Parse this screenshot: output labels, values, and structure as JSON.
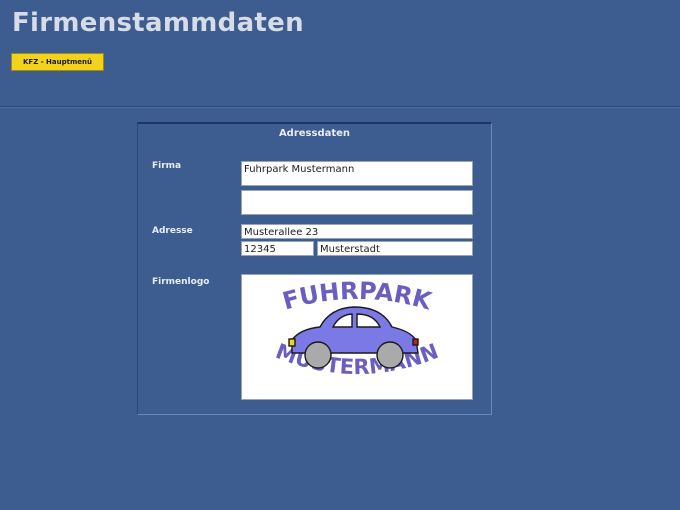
{
  "page": {
    "title": "Firmenstammdaten",
    "menu_button": "KFZ - Hauptmenü"
  },
  "panel": {
    "title": "Adressdaten",
    "labels": {
      "firma": "Firma",
      "adresse": "Adresse",
      "firmenlogo": "Firmenlogo"
    },
    "fields": {
      "firma_line1": "Fuhrpark Mustermann",
      "firma_line2": "",
      "strasse": "Musterallee 23",
      "plz": "12345",
      "ort": "Musterstadt"
    },
    "logo": {
      "top_text": "FUHRPARK",
      "bottom_text": "MUSTERMANN",
      "text_color": "#6a5fc0",
      "car_color": "#7b79e6"
    }
  },
  "colors": {
    "background": "#3d5c8f",
    "button": "#f3d21c",
    "title": "#d7dce6"
  }
}
